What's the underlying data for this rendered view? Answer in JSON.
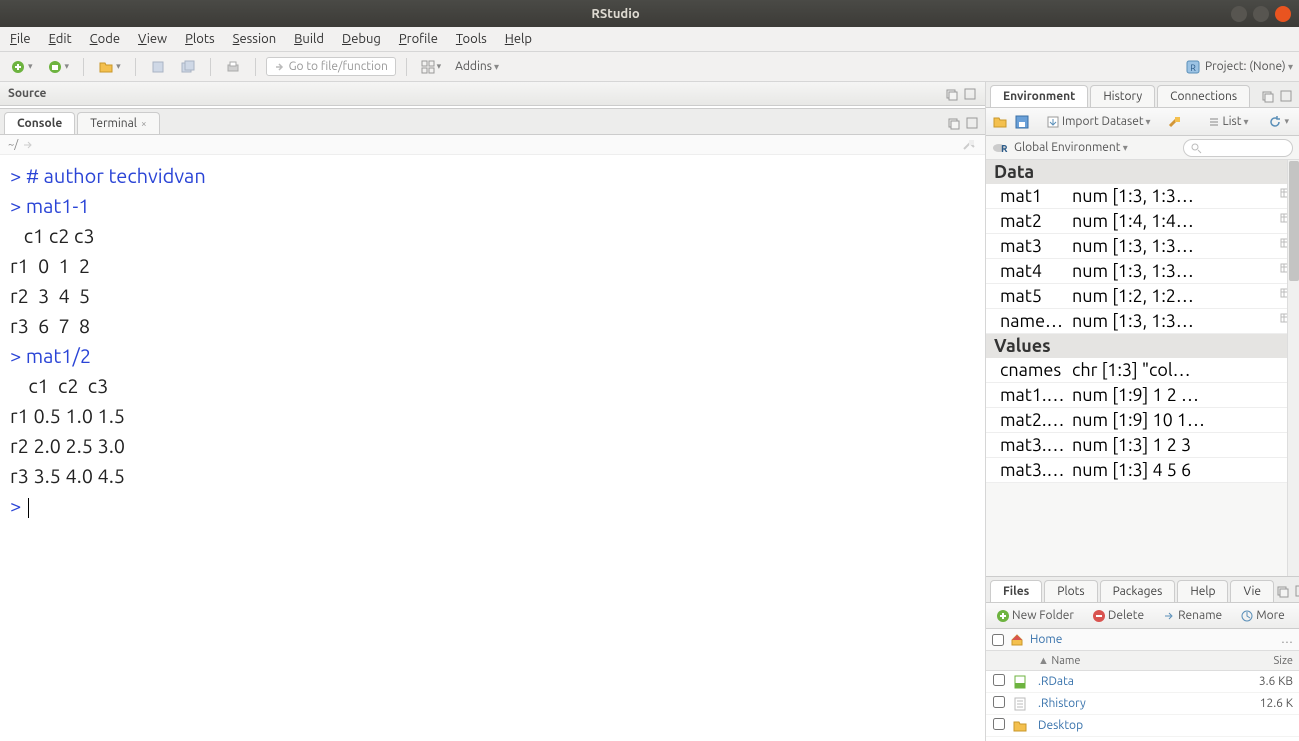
{
  "title": "RStudio",
  "menubar": [
    "File",
    "Edit",
    "Code",
    "View",
    "Plots",
    "Session",
    "Build",
    "Debug",
    "Profile",
    "Tools",
    "Help"
  ],
  "toolbar": {
    "gotofile": "Go to file/function",
    "addins": "Addins",
    "project": "Project: (None)"
  },
  "source": {
    "title": "Source"
  },
  "console": {
    "tabs": [
      "Console",
      "Terminal"
    ],
    "active": 0,
    "wd": "~/",
    "lines": [
      {
        "t": "prompt",
        "s": "> "
      },
      {
        "t": "comment",
        "s": "# author techvidvan"
      },
      {
        "t": "nl"
      },
      {
        "t": "prompt",
        "s": "> "
      },
      {
        "t": "input",
        "s": "mat1-1"
      },
      {
        "t": "nl"
      },
      {
        "t": "out",
        "s": "   c1 c2 c3"
      },
      {
        "t": "nl"
      },
      {
        "t": "out",
        "s": "r1  0  1  2"
      },
      {
        "t": "nl"
      },
      {
        "t": "out",
        "s": "r2  3  4  5"
      },
      {
        "t": "nl"
      },
      {
        "t": "out",
        "s": "r3  6  7  8"
      },
      {
        "t": "nl"
      },
      {
        "t": "prompt",
        "s": "> "
      },
      {
        "t": "input",
        "s": "mat1/2"
      },
      {
        "t": "nl"
      },
      {
        "t": "out",
        "s": "    c1  c2  c3"
      },
      {
        "t": "nl"
      },
      {
        "t": "out",
        "s": "r1 0.5 1.0 1.5"
      },
      {
        "t": "nl"
      },
      {
        "t": "out",
        "s": "r2 2.0 2.5 3.0"
      },
      {
        "t": "nl"
      },
      {
        "t": "out",
        "s": "r3 3.5 4.0 4.5"
      },
      {
        "t": "nl"
      },
      {
        "t": "prompt",
        "s": "> "
      },
      {
        "t": "cursor"
      }
    ]
  },
  "env": {
    "tabs": [
      "Environment",
      "History",
      "Connections"
    ],
    "active": 0,
    "import": "Import Dataset",
    "list": "List",
    "scope": "Global Environment",
    "sections": [
      {
        "name": "Data",
        "rows": [
          {
            "n": "mat1",
            "v": "num [1:3, 1:3…",
            "icon": true
          },
          {
            "n": "mat2",
            "v": "num [1:4, 1:4…",
            "icon": true
          },
          {
            "n": "mat3",
            "v": "num [1:3, 1:3…",
            "icon": true
          },
          {
            "n": "mat4",
            "v": "num [1:3, 1:3…",
            "icon": true
          },
          {
            "n": "mat5",
            "v": "num [1:2, 1:2…",
            "icon": true
          },
          {
            "n": "named…",
            "v": "num [1:3, 1:3…",
            "icon": true
          }
        ]
      },
      {
        "name": "Values",
        "rows": [
          {
            "n": "cnames",
            "v": "chr [1:3] \"col…",
            "icon": false
          },
          {
            "n": "mat1.…",
            "v": "num [1:9] 1 2 …",
            "icon": false
          },
          {
            "n": "mat2.…",
            "v": "num [1:9] 10 1…",
            "icon": false
          },
          {
            "n": "mat3.…",
            "v": "num [1:3] 1 2 3",
            "icon": false
          },
          {
            "n": "mat3.…",
            "v": "num [1:3] 4 5 6",
            "icon": false
          }
        ]
      }
    ]
  },
  "files": {
    "tabs": [
      "Files",
      "Plots",
      "Packages",
      "Help",
      "Vie"
    ],
    "active": 0,
    "toolbar": {
      "newfolder": "New Folder",
      "delete": "Delete",
      "rename": "Rename",
      "more": "More"
    },
    "path": "Home",
    "cols": {
      "name": "Name",
      "size": "Size"
    },
    "rows": [
      {
        "icon": "rdata",
        "name": ".RData",
        "size": "3.6 KB"
      },
      {
        "icon": "file",
        "name": ".Rhistory",
        "size": "12.6 K"
      },
      {
        "icon": "folder",
        "name": "Desktop",
        "size": ""
      }
    ]
  }
}
